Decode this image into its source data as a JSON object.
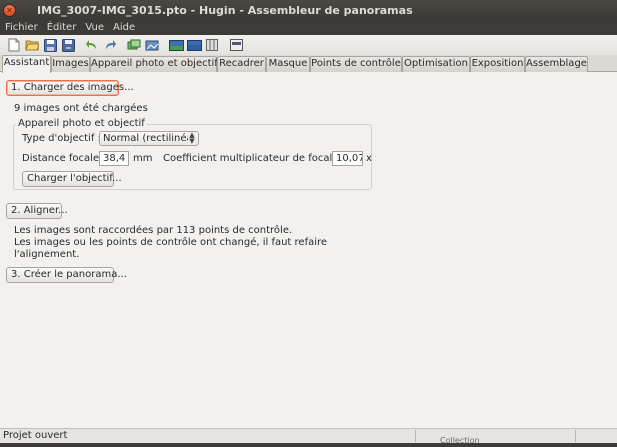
{
  "window": {
    "title": "IMG_3007-IMG_3015.pto - Hugin - Assembleur de panoramas"
  },
  "menu": [
    "Fichier",
    "Éditer",
    "Vue",
    "Aide"
  ],
  "toolbar": {
    "icons": [
      "new-file-icon",
      "open-folder-icon",
      "save-icon",
      "save-as-icon",
      "undo-icon",
      "redo-icon",
      "add-images-icon",
      "align-images-icon",
      "preview-panorama-icon",
      "fast-preview-icon",
      "layout-view-icon",
      "stitch-icon"
    ]
  },
  "tabs": [
    "Assistant",
    "Images",
    "Appareil photo et objectif",
    "Recadrer",
    "Masque",
    "Points de contrôle",
    "Optimisation",
    "Exposition",
    "Assemblage"
  ],
  "assistant": {
    "load_button": "1. Charger des images...",
    "loaded_text": "9 images ont été chargées",
    "camera_group_title": "Appareil photo et objectif",
    "lens_type_label": "Type d'objectif :",
    "lens_type_value": "Normal (rectilinéa",
    "focal_length_label": "Distance focale :",
    "focal_length_value": "38,4",
    "focal_length_unit": "mm",
    "crop_factor_label": "Coefficient multiplicateur de focale :",
    "crop_factor_value": "10,07",
    "crop_factor_unit": "x",
    "load_lens_button": "Charger l'objectif...",
    "align_button": "2. Aligner...",
    "align_info_1": "Les images sont raccordées par 113 points de contrôle.",
    "align_info_2": "Les images ou les points de contrôle ont changé, il faut refaire",
    "align_info_3": "l'alignement.",
    "create_button": "3. Créer le panorama..."
  },
  "status": {
    "text": "Projet ouvert",
    "clipped_text": "Collection"
  }
}
